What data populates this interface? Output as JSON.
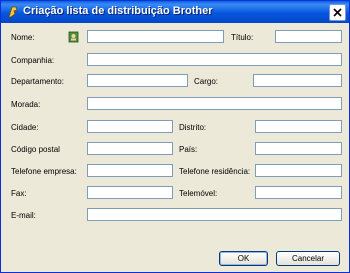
{
  "window": {
    "title": "Criação lista de distribuição Brother"
  },
  "fields": {
    "nome": "Nome:",
    "titulo": "Título:",
    "companhia": "Companhia:",
    "departamento": "Departamento:",
    "cargo": "Cargo:",
    "morada": "Morada:",
    "cidade": "Cidade:",
    "distrito": "Distrito:",
    "codigo_postal": "Código postal",
    "pais": "País:",
    "telefone_empresa": "Telefone empresa:",
    "telefone_residencia": "Telefone residência:",
    "fax": "Fax:",
    "telemovel": "Telemóvel:",
    "email": "E-mail:"
  },
  "buttons": {
    "ok": "OK",
    "cancel": "Cancelar"
  },
  "icons": {
    "app": "brother-icon",
    "address_book": "address-book-icon",
    "close": "close-icon"
  }
}
